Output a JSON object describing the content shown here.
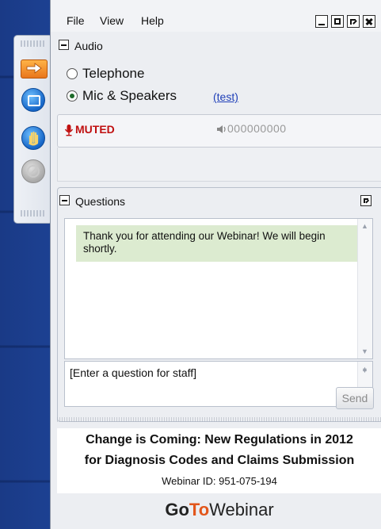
{
  "menu": {
    "file": "File",
    "view": "View",
    "help": "Help"
  },
  "audio": {
    "title": "Audio",
    "options": [
      "Telephone",
      "Mic & Speakers"
    ],
    "selected": "Mic & Speakers",
    "test_link": "(test)",
    "muted_label": "MUTED",
    "volume_meter": "000000000"
  },
  "questions": {
    "title": "Questions",
    "message": "Thank you for attending our Webinar! We will begin shortly.",
    "input_placeholder": "[Enter a question for staff]",
    "send_label": "Send"
  },
  "webinar": {
    "title_line1": "Change is Coming: New Regulations in 2012",
    "title_line2": "for Diagnosis Codes and Claims Submission",
    "id_text": "Webinar ID: 951-075-194"
  },
  "brand": {
    "go": "Go",
    "to": "To",
    "webinar": "Webinar"
  },
  "colors": {
    "accent_orange": "#e2561b",
    "muted_red": "#c01010",
    "message_bg": "#dcebd0"
  }
}
